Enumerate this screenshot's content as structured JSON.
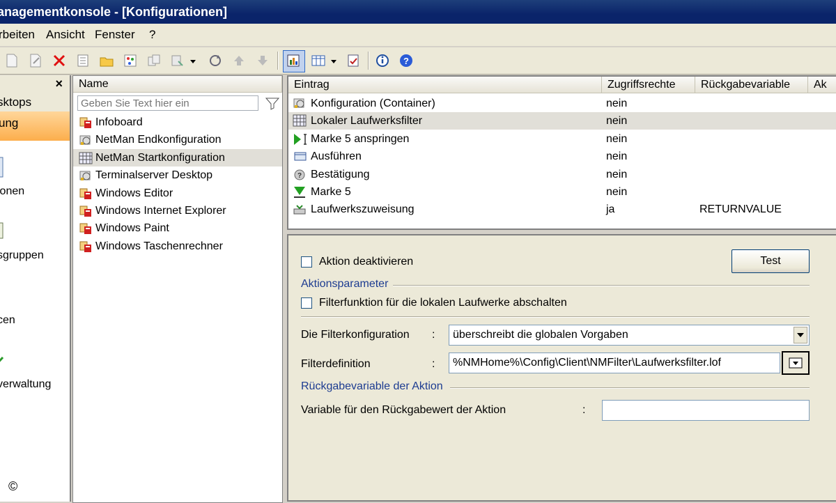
{
  "window": {
    "title": "anagementkonsole - [Konfigurationen]"
  },
  "menu": [
    {
      "label": "rbeiten"
    },
    {
      "label": "Ansicht"
    },
    {
      "label": "Fenster"
    },
    {
      "label": "?"
    }
  ],
  "toolbar": {
    "icons": [
      "new-icon",
      "edit-icon",
      "delete-icon",
      "properties-icon",
      "open-folder-icon",
      "wizard-icon",
      "copy-icon",
      "link-icon",
      "refresh-icon",
      "up-arrow-icon",
      "down-arrow-icon",
      "tree-view-icon",
      "list-view-icon",
      "checklist-icon",
      "info-icon",
      "help-icon"
    ]
  },
  "leftnav": {
    "close": "×",
    "desktops": "sktops",
    "active": "ung",
    "items": [
      {
        "label": "ionen"
      },
      {
        "label": "sgruppen"
      },
      {
        "label": "cen"
      },
      {
        "label": "verwaltung"
      }
    ]
  },
  "namelist": {
    "header": "Name",
    "filter_placeholder": "Geben Sie Text hier ein",
    "items": [
      {
        "label": "Infoboard",
        "icon": "app-icon"
      },
      {
        "label": "NetMan Endkonfiguration",
        "icon": "config-icon"
      },
      {
        "label": "NetMan Startkonfiguration",
        "icon": "grid-config-icon",
        "selected": true
      },
      {
        "label": "Terminalserver Desktop",
        "icon": "config-icon"
      },
      {
        "label": "Windows Editor",
        "icon": "app-icon"
      },
      {
        "label": "Windows Internet Explorer",
        "icon": "app-icon"
      },
      {
        "label": "Windows Paint",
        "icon": "app-icon"
      },
      {
        "label": "Windows Taschenrechner",
        "icon": "app-icon"
      }
    ]
  },
  "entries": {
    "headers": [
      "Eintrag",
      "Zugriffsrechte",
      "Rückgabevariable",
      "Ak"
    ],
    "rows": [
      {
        "name": "Konfiguration (Container)",
        "rights": "nein",
        "ret": "",
        "icon": "config-icon"
      },
      {
        "name": "Lokaler Laufwerksfilter",
        "rights": "nein",
        "ret": "",
        "icon": "grid-config-icon",
        "selected": true
      },
      {
        "name": "Marke 5 anspringen",
        "rights": "nein",
        "ret": "",
        "icon": "jump-icon"
      },
      {
        "name": "Ausführen",
        "rights": "nein",
        "ret": "",
        "icon": "execute-icon"
      },
      {
        "name": "Bestätigung",
        "rights": "nein",
        "ret": "",
        "icon": "confirm-icon"
      },
      {
        "name": "Marke 5",
        "rights": "nein",
        "ret": "",
        "icon": "marker-icon"
      },
      {
        "name": "Laufwerkszuweisung",
        "rights": "ja",
        "ret": "RETURNVALUE",
        "icon": "drive-icon"
      }
    ]
  },
  "details": {
    "disable_action": "Aktion deaktivieren",
    "test": "Test",
    "params_group": "Aktionsparameter",
    "filter_off": "Filterfunktion für die lokalen Laufwerke abschalten",
    "filterconfig_label": "Die Filterkonfiguration",
    "filterconfig_value": "überschreibt die globalen Vorgaben",
    "filterdef_label": "Filterdefinition",
    "filterdef_value": "%NMHome%\\Config\\Client\\NMFilter\\Laufwerksfilter.lof",
    "return_group": "Rückgabevariable der Aktion",
    "return_label": "Variable für den Rückgabewert der Aktion",
    "return_value": "",
    "colon": ":"
  },
  "copyright": "©"
}
